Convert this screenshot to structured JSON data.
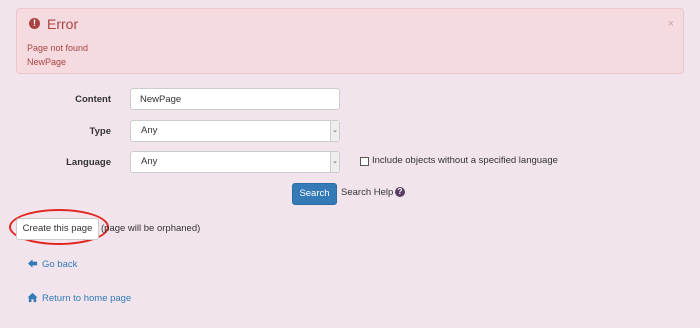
{
  "alert": {
    "title": "Error",
    "lines": [
      "Page not found",
      "NewPage"
    ],
    "close": "×",
    "icon": "exclamation-circle-icon",
    "color": "#a94442"
  },
  "form": {
    "content": {
      "label": "Content",
      "value": "NewPage"
    },
    "type": {
      "label": "Type",
      "selected": "Any"
    },
    "language": {
      "label": "Language",
      "selected": "Any"
    },
    "include_no_language": {
      "label": "Include objects without a specified language",
      "checked": false
    },
    "search_button": "Search",
    "search_help": "Search Help"
  },
  "create": {
    "button": "Create this page",
    "note": "(page will be orphaned)",
    "highlight_color": "#e0261f"
  },
  "links": {
    "go_back": "Go back",
    "home": "Return to home page"
  },
  "accent": "#337ab7"
}
